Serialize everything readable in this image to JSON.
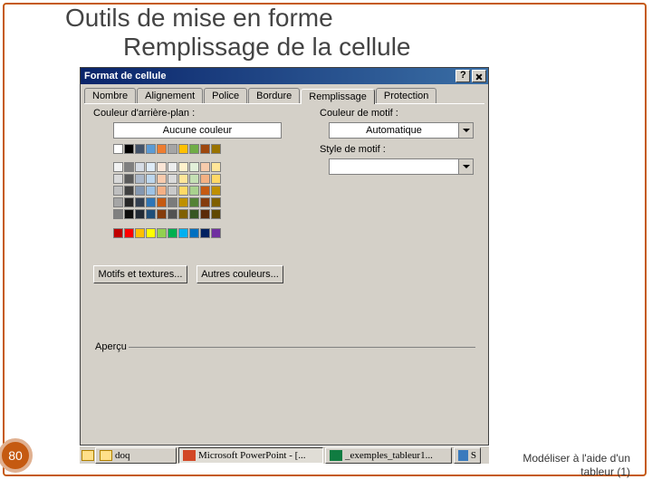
{
  "slide": {
    "title1": "Outils de mise en forme",
    "title2": "Remplissage de la cellule",
    "page_number": "80",
    "footer_line1": "Modéliser à l'aide d'un",
    "footer_line2": "tableur (1)"
  },
  "dialog": {
    "title": "Format de cellule",
    "tabs": {
      "number": "Nombre",
      "alignment": "Alignement",
      "font": "Police",
      "border": "Bordure",
      "fill": "Remplissage",
      "protection": "Protection"
    },
    "labels": {
      "bg_color": "Couleur d'arrière-plan :",
      "pattern_color": "Couleur de motif :",
      "pattern_style": "Style de motif :",
      "no_color": "Aucune couleur",
      "fill_effects": "Motifs et textures...",
      "more_colors": "Autres couleurs...",
      "preview": "Aperçu"
    },
    "combos": {
      "pattern_color_value": "Automatique",
      "pattern_style_value": ""
    }
  },
  "palette": {
    "theme_row": [
      "#ffffff",
      "#000000",
      "#44546a",
      "#5b9bd5",
      "#ed7d31",
      "#a5a5a5",
      "#ffc000",
      "#70ad47",
      "#9e480e",
      "#997300"
    ],
    "tints": [
      [
        "#f2f2f2",
        "#7f7f7f",
        "#d6dce5",
        "#deebf7",
        "#fbe5d6",
        "#ededed",
        "#fff2cc",
        "#e2f0d9",
        "#f7cbac",
        "#ffe699"
      ],
      [
        "#d9d9d9",
        "#595959",
        "#adb9ca",
        "#bdd7ee",
        "#f8cbad",
        "#dbdbdb",
        "#ffe699",
        "#c5e0b4",
        "#f4b183",
        "#ffd966"
      ],
      [
        "#bfbfbf",
        "#404040",
        "#8497b0",
        "#9dc3e6",
        "#f4b084",
        "#c9c9c9",
        "#ffd966",
        "#a9d18e",
        "#c55a11",
        "#bf8f00"
      ],
      [
        "#a6a6a6",
        "#262626",
        "#333f50",
        "#2e75b6",
        "#c55a11",
        "#7b7b7b",
        "#bf9000",
        "#548235",
        "#843c0c",
        "#806000"
      ],
      [
        "#808080",
        "#0d0d0d",
        "#222a35",
        "#1f4e79",
        "#843c0c",
        "#525252",
        "#806000",
        "#385723",
        "#5a2a08",
        "#604800"
      ]
    ],
    "std_row": [
      "#c00000",
      "#ff0000",
      "#ffc000",
      "#ffff00",
      "#92d050",
      "#00b050",
      "#00b0f0",
      "#0070c0",
      "#002060",
      "#7030a0"
    ]
  },
  "taskbar": {
    "item1": "doq",
    "item2": "Microsoft PowerPoint - [...",
    "item3": "_exemples_tableur1...",
    "item4": "S"
  }
}
